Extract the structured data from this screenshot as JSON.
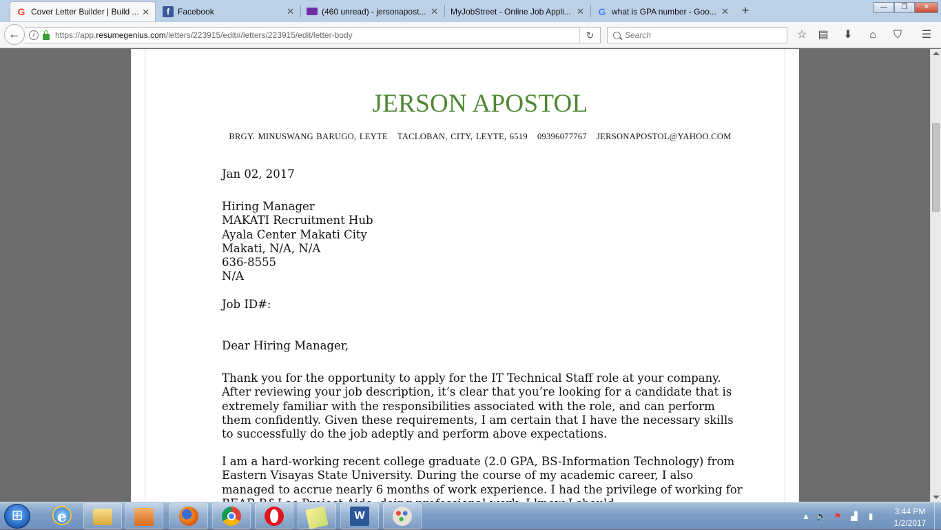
{
  "browser": {
    "tabs": [
      {
        "title": "Cover Letter Builder | Build ...",
        "favicon": "google-icon",
        "active": true
      },
      {
        "title": "Facebook",
        "favicon": "facebook-icon",
        "active": false
      },
      {
        "title": "(460 unread) - jersonapost...",
        "favicon": "yahoo-mail-icon",
        "active": false
      },
      {
        "title": "MyJobStreet - Online Job Appli...",
        "favicon": "none",
        "active": false
      },
      {
        "title": "what is GPA number - Goo...",
        "favicon": "google-icon",
        "active": false
      }
    ],
    "new_tab": "+",
    "window_controls": {
      "minimize": "—",
      "maximize": "❐",
      "close": "✕"
    },
    "address": {
      "prefix": "https://app.",
      "host": "resumegenius.com",
      "path": "/letters/223915/edit#/letters/223915/edit/letter-body"
    },
    "search_placeholder": "Search",
    "toolbar_icons": [
      "bookmark-star-icon",
      "reading-list-icon",
      "download-icon",
      "home-icon",
      "pocket-icon",
      "menu-icon"
    ]
  },
  "letter": {
    "name": "JERSON APOSTOL",
    "contact": {
      "address1": "BRGY. MINUSWANG BARUGO, LEYTE",
      "address2": "TACLOBAN, CITY, LEYTE, 6519",
      "phone": "09396077767",
      "email": "JERSONAPOSTOL@YAHOO.COM"
    },
    "date": "Jan 02, 2017",
    "recipient": {
      "line1": "Hiring Manager",
      "line2": "MAKATI Recruitment Hub",
      "line3": "Ayala Center Makati City",
      "line4": "Makati, N/A, N/A",
      "line5": "636-8555",
      "line6": "N/A"
    },
    "job_id": "Job ID#:",
    "salutation": "Dear Hiring Manager,",
    "paragraph1": "Thank you for the opportunity to apply for the IT Technical Staff role at your company. After reviewing your job description, it’s clear that you’re looking for a candidate that is extremely familiar with the responsibilities associated with the role, and can perform them confidently. Given these requirements, I am certain that I have the necessary skills to successfully do the job adeptly and perform above expectations.",
    "paragraph2": "I am a hard-working recent college graduate (2.0 GPA, BS-Information Technology) from Eastern Visayas State University. During the course of my academic career, I also managed to accrue nearly 6 months of work experience. I had the privilege of working for BEAR R&I as Project Aide, doing professional work. I know I should..."
  },
  "taskbar": {
    "apps": [
      "internet-explorer-icon",
      "file-explorer-icon",
      "media-player-icon",
      "firefox-icon",
      "chrome-icon",
      "opera-icon",
      "sticky-notes-icon",
      "word-icon",
      "paint-icon"
    ],
    "time": "3:44 PM",
    "date": "1/2/2017"
  },
  "colors": {
    "name_green": "#4e8733",
    "tabstrip": "#bcd0e8",
    "page_bg": "#6d6d6d"
  }
}
